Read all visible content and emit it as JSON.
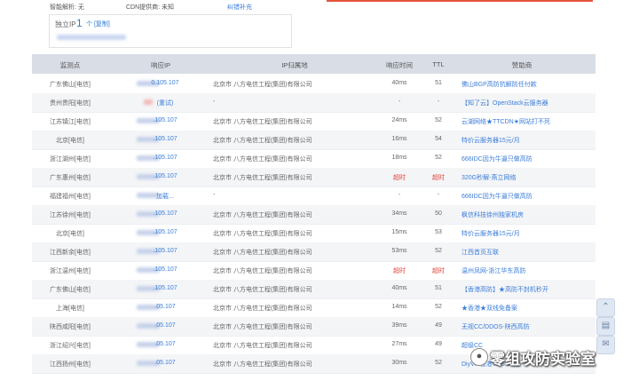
{
  "top": {
    "dns_label": "智能解析: 无",
    "cdn_label": "CDN提供商: 未知",
    "report_link": "纠错补充"
  },
  "ip_box": {
    "label": "独立IP",
    "count": "1",
    "unit": "个 [复制]"
  },
  "table": {
    "headers": [
      "监测点",
      "响应IP",
      "IP归属地",
      "响应时间",
      "TTL",
      "赞助商"
    ],
    "rows": [
      {
        "loc": "广东佛山[电信]",
        "ip": "0.105.107",
        "addr": "北京市 八方电信工程(集团)有限公司",
        "time": "40ms",
        "ttl": "51",
        "spon": "佛山BGP高防抗解防任付款"
      },
      {
        "loc": "贵州贵阳[电信]",
        "ip": "(重试)",
        "addr": "-",
        "time": "-",
        "ttl": "-",
        "spon": "【知了云】OpenStack云服务器"
      },
      {
        "loc": "江苏镇江[电信]",
        "ip": ".105.107",
        "addr": "北京市 八方电信工程(集团)有限公司",
        "time": "24ms",
        "ttl": "52",
        "spon": "云湖网络★TTCDN★网站打不死"
      },
      {
        "loc": "北京[电信]",
        "ip": ".105.107",
        "addr": "北京市 八方电信工程(集团)有限公司",
        "time": "16ms",
        "ttl": "54",
        "spon": "特价云服务器15元/月"
      },
      {
        "loc": "浙江湖州[电信]",
        "ip": ".105.107",
        "addr": "北京市 八方电信工程(集团)有限公司",
        "time": "18ms",
        "ttl": "52",
        "spon": "666IDC因为牛逼只做高防"
      },
      {
        "loc": "广东惠州[电信]",
        "ip": ".105.107",
        "addr": "北京市 八方电信工程(集团)有限公司",
        "time": "超时",
        "ttl": "超时",
        "spon": "320G秒解-燕立网络",
        "timeout": true
      },
      {
        "loc": "福建福州[电信]",
        "ip": "加载...",
        "addr": "-",
        "time": "-",
        "ttl": "-",
        "spon": "666IDC因为牛逼只做高防"
      },
      {
        "loc": "江苏徐州[电信]",
        "ip": ".105.107",
        "addr": "北京市 八方电信工程(集团)有限公司",
        "time": "34ms",
        "ttl": "50",
        "spon": "枫信科技徐州独家机房"
      },
      {
        "loc": "北京[电信]",
        "ip": ".105.107",
        "addr": "北京市 八方电信工程(集团)有限公司",
        "time": "15ms",
        "ttl": "53",
        "spon": "特价云服务器15元/月"
      },
      {
        "loc": "江西新余[电信]",
        "ip": ".105.107",
        "addr": "北京市 八方电信工程(集团)有限公司",
        "time": "53ms",
        "ttl": "52",
        "spon": "江西首页互联"
      },
      {
        "loc": "浙江温州[电信]",
        "ip": ".105.107",
        "addr": "北京市 八方电信工程(集团)有限公司",
        "time": "超时",
        "ttl": "超时",
        "spon": "温州凤网-浙江华东高防",
        "timeout": true
      },
      {
        "loc": "广东佛山[电信]",
        "ip": ".105.107",
        "addr": "北京市 八方电信工程(集团)有限公司",
        "time": "40ms",
        "ttl": "51",
        "spon": "【香港高防】★高防不封机秒开"
      },
      {
        "loc": "上海[电信]",
        "ip": ".05.107",
        "addr": "北京市 八方电信工程(集团)有限公司",
        "time": "14ms",
        "ttl": "52",
        "spon": "★香港★双线免备案"
      },
      {
        "loc": "陕西咸阳[电信]",
        "ip": ".05.107",
        "addr": "北京市 八方电信工程(集团)有限公司",
        "time": "39ms",
        "ttl": "49",
        "spon": "无视CC/DDOS-陕西高防"
      },
      {
        "loc": "浙江绍兴[电信]",
        "ip": ".05.107",
        "addr": "北京市 八方电信工程(集团)有限公司",
        "time": "27ms",
        "ttl": "49",
        "spon": "超级CC"
      },
      {
        "loc": "江西扬州[电信]",
        "ip": ".05.107",
        "addr": "北京市 八方电信工程(集团)有限公司",
        "time": "30ms",
        "ttl": "52",
        "spon": "DiyVM香港VPS 36元"
      }
    ]
  },
  "watermark": "零组攻防实验室",
  "colors": {
    "header_bg": "#d9dde6",
    "link": "#3b7dd8",
    "timeout": "#e0423a",
    "accent": "#e2533c"
  },
  "icons": [
    "chevron-up-icon",
    "comment-icon",
    "mail-icon",
    "wechat-icon"
  ]
}
